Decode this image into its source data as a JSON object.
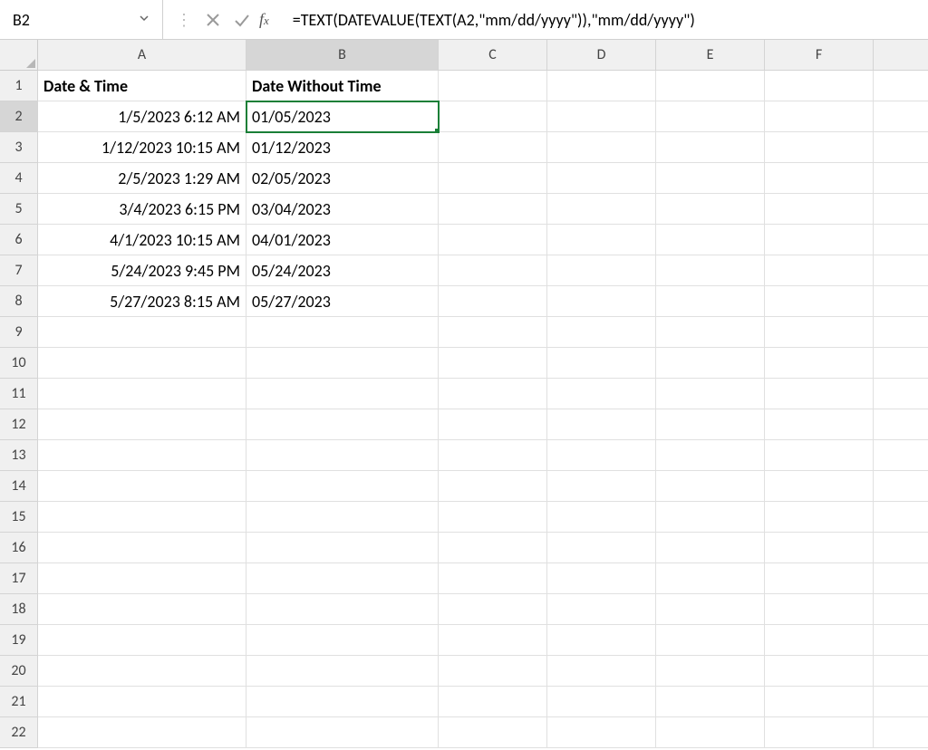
{
  "nameBox": {
    "value": "B2"
  },
  "formula": "=TEXT(DATEVALUE(TEXT(A2,\"mm/dd/yyyy\")),\"mm/dd/yyyy\")",
  "columns": [
    "A",
    "B",
    "C",
    "D",
    "E",
    "F"
  ],
  "rowsCount": 22,
  "selectedCell": {
    "col": "B",
    "row": 2
  },
  "headers": {
    "A": "Date & Time",
    "B": "Date Without Time"
  },
  "data": [
    {
      "a": "1/5/2023 6:12 AM",
      "b": "01/05/2023"
    },
    {
      "a": "1/12/2023 10:15 AM",
      "b": "01/12/2023"
    },
    {
      "a": "2/5/2023 1:29 AM",
      "b": "02/05/2023"
    },
    {
      "a": "3/4/2023 6:15 PM",
      "b": "03/04/2023"
    },
    {
      "a": "4/1/2023 10:15 AM",
      "b": "04/01/2023"
    },
    {
      "a": "5/24/2023 9:45 PM",
      "b": "05/24/2023"
    },
    {
      "a": "5/27/2023 8:15 AM",
      "b": "05/27/2023"
    }
  ]
}
